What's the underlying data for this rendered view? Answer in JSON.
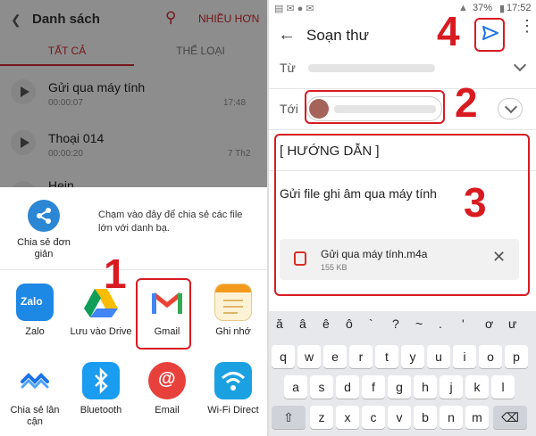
{
  "left": {
    "app_title": "Danh sách",
    "more_label": "NHIỀU HƠN",
    "tabs": [
      "TẤT CẢ",
      "THỂ LOẠI"
    ],
    "recordings": [
      {
        "title": "Gửi qua máy tính",
        "duration": "00:00:07",
        "time": "17:48"
      },
      {
        "title": "Thoại 014",
        "duration": "00:00:20",
        "time": "7 Th2"
      },
      {
        "title": "Hein",
        "duration": "",
        "time": ""
      }
    ],
    "share_hint": {
      "label": "Chia sẻ đơn giản",
      "text": "Chạm vào đây để chia sẻ các file lớn với danh bạ."
    },
    "apps": [
      {
        "label": "Zalo",
        "icon": "zalo-icon"
      },
      {
        "label": "Lưu vào Drive",
        "icon": "drive-icon"
      },
      {
        "label": "Gmail",
        "icon": "gmail-icon"
      },
      {
        "label": "Ghi nhớ",
        "icon": "notes-icon"
      },
      {
        "label": "Chia sẻ lân cận",
        "icon": "nearby-share-icon"
      },
      {
        "label": "Bluetooth",
        "icon": "bluetooth-icon"
      },
      {
        "label": "Email",
        "icon": "email-icon"
      },
      {
        "label": "Wi-Fi Direct",
        "icon": "wifi-direct-icon"
      }
    ],
    "step_number": "1"
  },
  "right": {
    "status": {
      "battery": "37%",
      "time": "17:52"
    },
    "compose_title": "Soạn thư",
    "from_label": "Từ",
    "to_label": "Tới",
    "subject": "[ HƯỚNG DẪN ]",
    "body": "Gửi file ghi âm qua máy tính",
    "attachment": {
      "name": "Gửi qua máy tính.m4a",
      "size": "155 KB"
    },
    "steps": {
      "recipient": "2",
      "body": "3",
      "send": "4"
    },
    "keyboard": {
      "row0": [
        "ă",
        "â",
        "ê",
        "ô",
        "`",
        "?",
        "~",
        ".",
        "'",
        "ơ",
        "ư"
      ],
      "row1": [
        "q",
        "w",
        "e",
        "r",
        "t",
        "y",
        "u",
        "i",
        "o",
        "p"
      ],
      "row2": [
        "a",
        "s",
        "d",
        "f",
        "g",
        "h",
        "j",
        "k",
        "l"
      ],
      "row3": [
        "z",
        "x",
        "c",
        "v",
        "b",
        "n",
        "m"
      ]
    }
  }
}
